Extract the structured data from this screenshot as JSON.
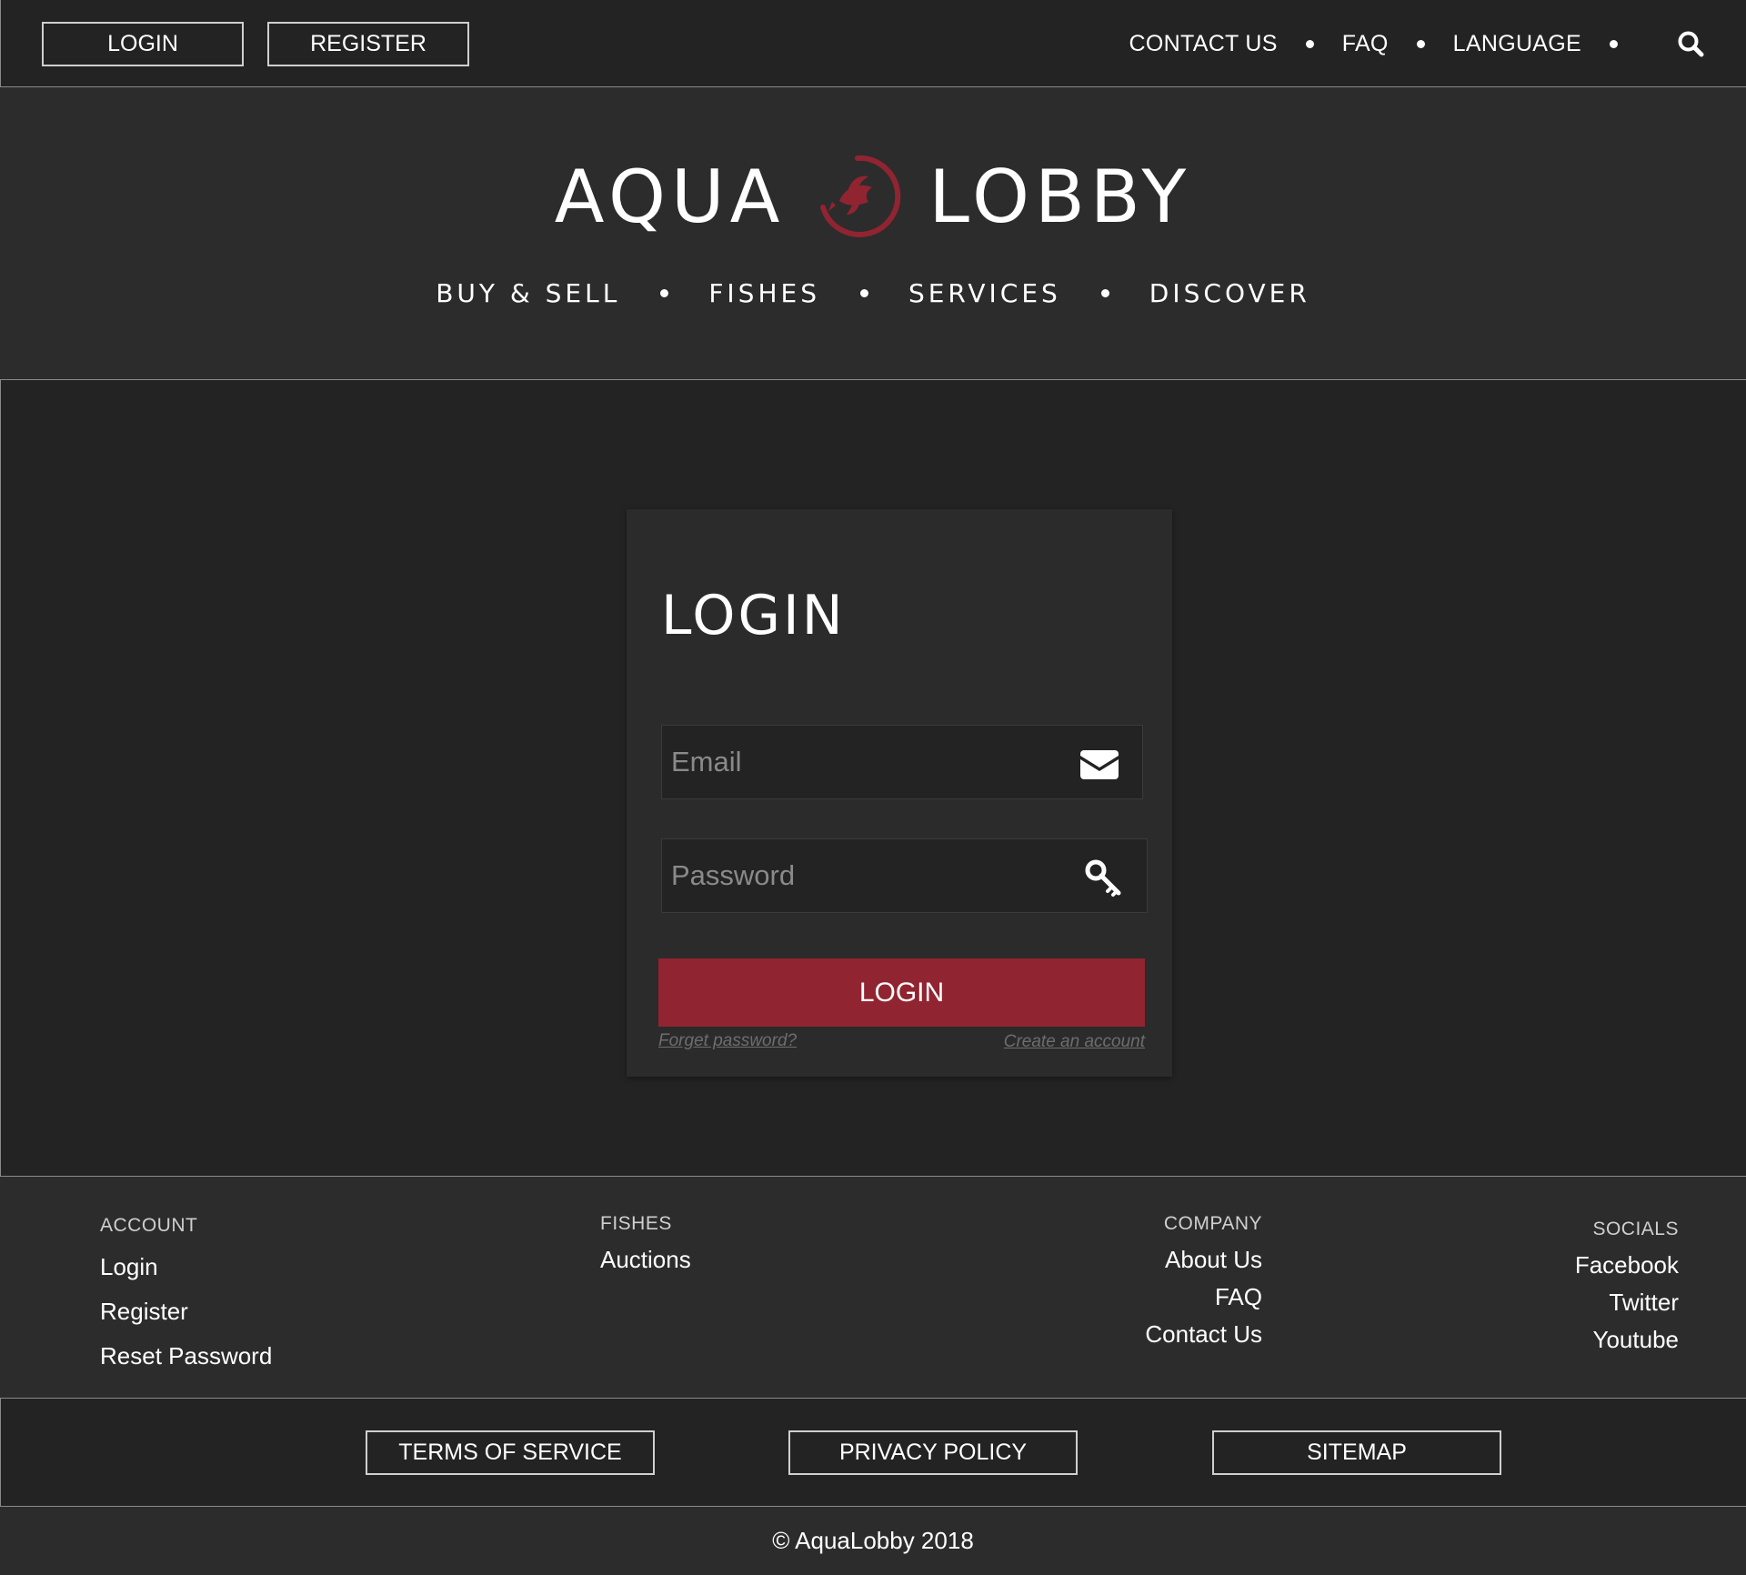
{
  "topbar": {
    "login_label": "LOGIN",
    "register_label": "REGISTER",
    "links": [
      "CONTACT US",
      "FAQ",
      "LANGUAGE"
    ],
    "search_icon": "search-icon"
  },
  "header": {
    "brand_left": "AQUA",
    "brand_right": "LOBBY",
    "logo_icon": "koi-fish-logo",
    "nav": [
      "BUY & SELL",
      "FISHES",
      "SERVICES",
      "DISCOVER"
    ]
  },
  "login_card": {
    "title": "LOGIN",
    "email_placeholder": "Email",
    "email_icon": "envelope-icon",
    "password_placeholder": "Password",
    "password_icon": "key-icon",
    "submit_label": "LOGIN",
    "forgot_link": "Forget password?",
    "create_link": "Create an account"
  },
  "footer": {
    "account": {
      "heading": "ACCOUNT",
      "links": [
        "Login",
        "Register",
        "Reset Password"
      ]
    },
    "fishes": {
      "heading": "FISHES",
      "links": [
        "Auctions"
      ]
    },
    "company": {
      "heading": "COMPANY",
      "links": [
        "About Us",
        "FAQ",
        "Contact Us"
      ]
    },
    "socials": {
      "heading": "SOCIALS",
      "links": [
        "Facebook",
        "Twitter",
        "Youtube"
      ]
    }
  },
  "legal": {
    "terms_label": "TERMS OF SERVICE",
    "privacy_label": "PRIVACY POLICY",
    "sitemap_label": "SITEMAP"
  },
  "copyright": "© AquaLobby 2018",
  "colors": {
    "accent": "#912431",
    "background": "#232323",
    "panel": "#2c2c2c"
  }
}
